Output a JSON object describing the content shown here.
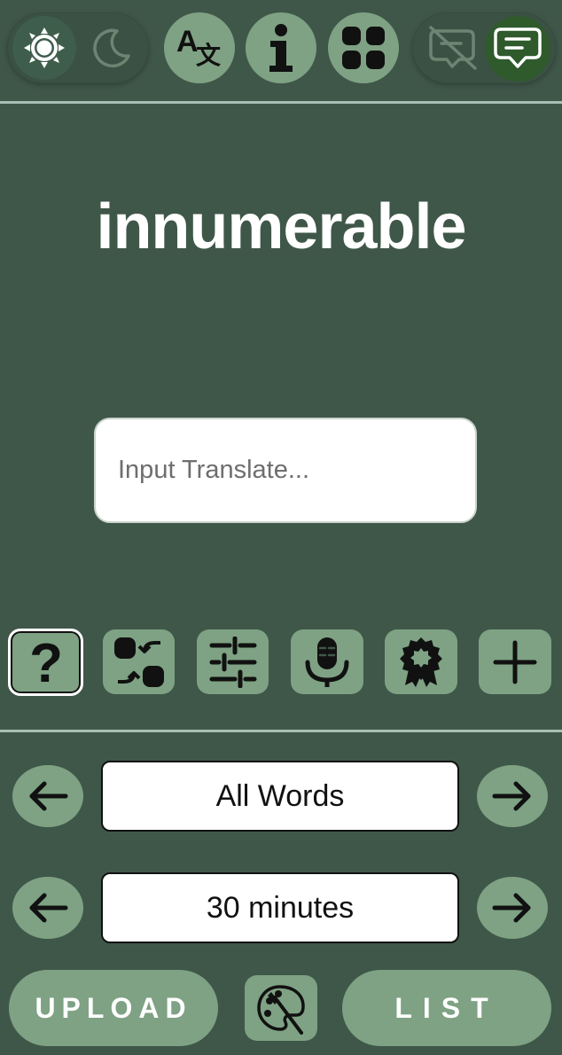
{
  "header": {
    "theme_toggle": {
      "light_icon": "sun-icon",
      "dark_icon": "moon-icon",
      "active": "light"
    },
    "buttons": [
      "translate-icon",
      "info-icon",
      "apps-grid-icon"
    ],
    "chat_toggle": {
      "off_icon": "chat-off-icon",
      "on_icon": "chat-icon",
      "active": "on"
    }
  },
  "main": {
    "word": "innumerable",
    "input": {
      "placeholder": "Input Translate...",
      "value": ""
    }
  },
  "toolbar": {
    "icons": [
      "help-icon",
      "swap-icon",
      "sliders-icon",
      "microphone-icon",
      "badge-icon",
      "plus-icon"
    ]
  },
  "filters": {
    "word_set": "All Words",
    "duration": "30 minutes"
  },
  "actions": {
    "upload_label": "UPLOAD",
    "list_label": "LIST",
    "palette_icon": "palette-icon"
  },
  "colors": {
    "background": "#3f5749",
    "button": "#7ea283",
    "active_chat": "#2f5a2c",
    "rule": "#a7bfb4"
  }
}
